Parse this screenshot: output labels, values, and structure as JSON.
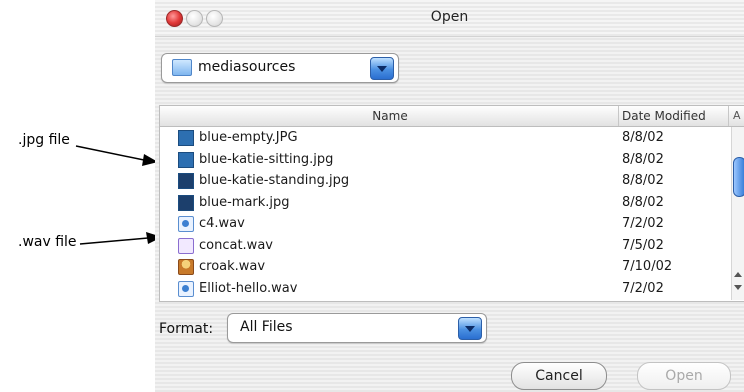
{
  "annotations": {
    "jpg_label": ".jpg file",
    "wav_label": ".wav file"
  },
  "window": {
    "title": "Open"
  },
  "location": {
    "selected": "mediasources"
  },
  "filelist": {
    "columns": {
      "name": "Name",
      "date": "Date Modified",
      "more": "A"
    },
    "rows": [
      {
        "name": "blue-empty.JPG",
        "date": "8/8/02",
        "icon": "jpg-file-icon"
      },
      {
        "name": "blue-katie-sitting.jpg",
        "date": "8/8/02",
        "icon": "jpg-file-icon"
      },
      {
        "name": "blue-katie-standing.jpg",
        "date": "8/8/02",
        "icon": "jpg-file-icon"
      },
      {
        "name": "blue-mark.jpg",
        "date": "8/8/02",
        "icon": "jpg-file-icon"
      },
      {
        "name": "c4.wav",
        "date": "7/2/02",
        "icon": "wav-file-icon"
      },
      {
        "name": "concat.wav",
        "date": "7/5/02",
        "icon": "wav-file-icon"
      },
      {
        "name": "croak.wav",
        "date": "7/10/02",
        "icon": "wav-file-icon"
      },
      {
        "name": "Elliot-hello.wav",
        "date": "7/2/02",
        "icon": "wav-file-icon"
      }
    ]
  },
  "format": {
    "label": "Format:",
    "selected": "All Files"
  },
  "buttons": {
    "cancel": "Cancel",
    "open": "Open"
  }
}
